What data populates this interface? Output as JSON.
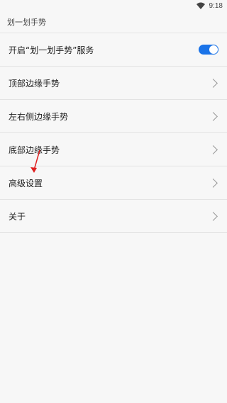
{
  "status_bar": {
    "time": "9:18",
    "icons": [
      "wifi-icon"
    ]
  },
  "header": {
    "title": "划一划手势"
  },
  "settings": {
    "items": [
      {
        "label": "开启“划一划手势”服务",
        "control": "toggle",
        "state": "on"
      },
      {
        "label": "顶部边缘手势",
        "control": "chevron"
      },
      {
        "label": "左右侧边缘手势",
        "control": "chevron"
      },
      {
        "label": "底部边缘手势",
        "control": "chevron"
      },
      {
        "label": "高级设置",
        "control": "chevron"
      },
      {
        "label": "关于",
        "control": "chevron"
      }
    ]
  },
  "colors": {
    "accent": "#1a73e8",
    "background": "#f7f7f7",
    "annotation_arrow": "#e02020"
  }
}
